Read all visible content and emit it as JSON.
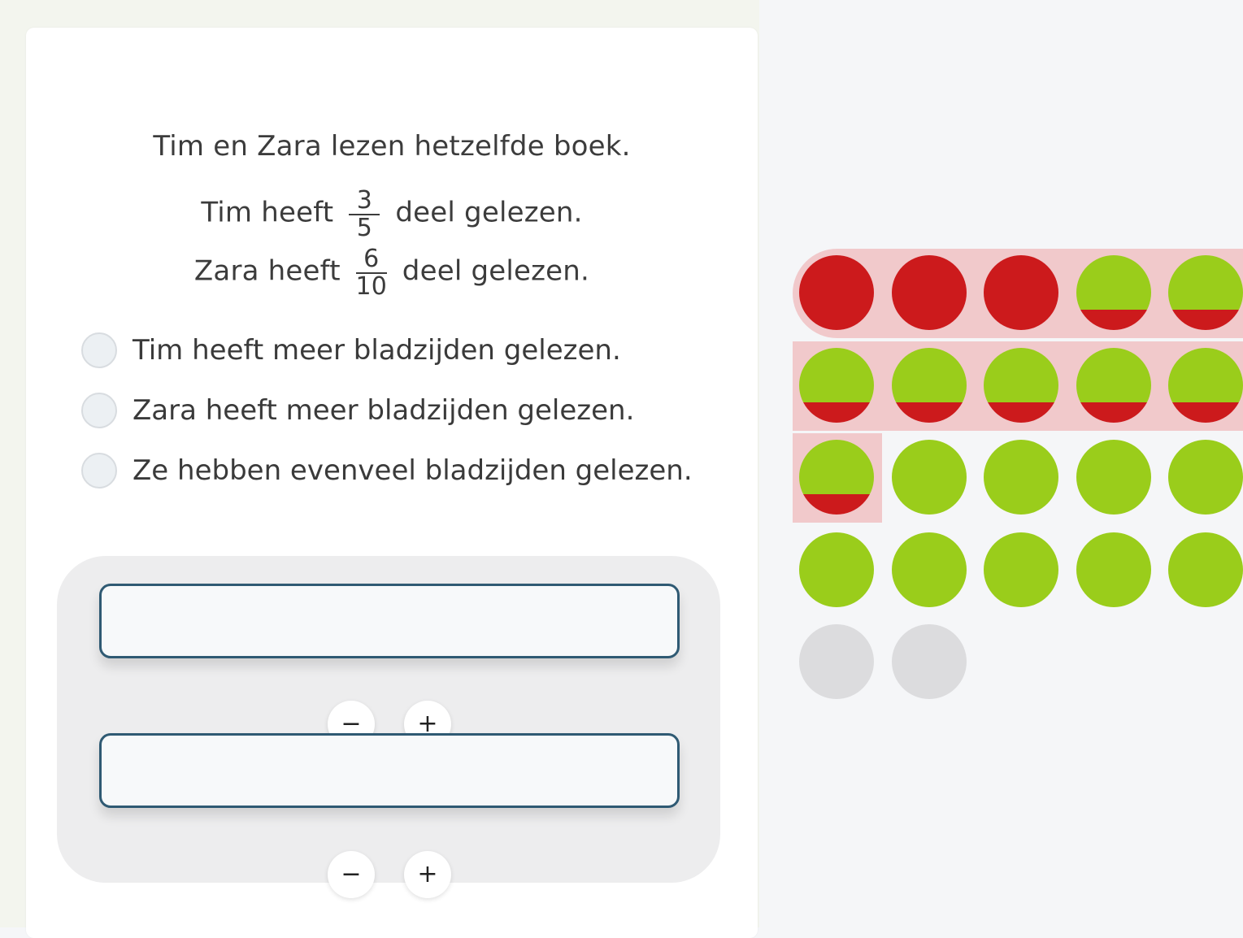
{
  "question": {
    "line1": "Tim en Zara lezen hetzelfde boek.",
    "line2_prefix": "Tim heeft",
    "line2_fraction": {
      "numerator": "3",
      "denominator": "5"
    },
    "line2_suffix": "deel gelezen.",
    "line3_prefix": "Zara heeft",
    "line3_fraction": {
      "numerator": "6",
      "denominator": "10"
    },
    "line3_suffix": "deel gelezen."
  },
  "options": [
    {
      "label": "Tim heeft meer bladzijden gelezen.",
      "selected": false
    },
    {
      "label": "Zara heeft meer bladzijden gelezen.",
      "selected": false
    },
    {
      "label": "Ze hebben evenveel bladzijden gelezen.",
      "selected": false
    }
  ],
  "answer_inputs": [
    {
      "value": "",
      "decrement_label": "−",
      "increment_label": "+"
    },
    {
      "value": "",
      "decrement_label": "−",
      "increment_label": "+"
    }
  ],
  "dot_grid": {
    "colors": {
      "red": "#cc1a1c",
      "green": "#9acd1b",
      "gray": "#dcdcde",
      "highlight": "#f1c9cb"
    },
    "rows": [
      [
        "red",
        "red",
        "red",
        "split",
        "split"
      ],
      [
        "split",
        "split",
        "split",
        "split",
        "split"
      ],
      [
        "split",
        "green",
        "green",
        "green",
        "green"
      ],
      [
        "green",
        "green",
        "green",
        "green",
        "green"
      ],
      [
        "gray",
        "gray"
      ]
    ]
  }
}
